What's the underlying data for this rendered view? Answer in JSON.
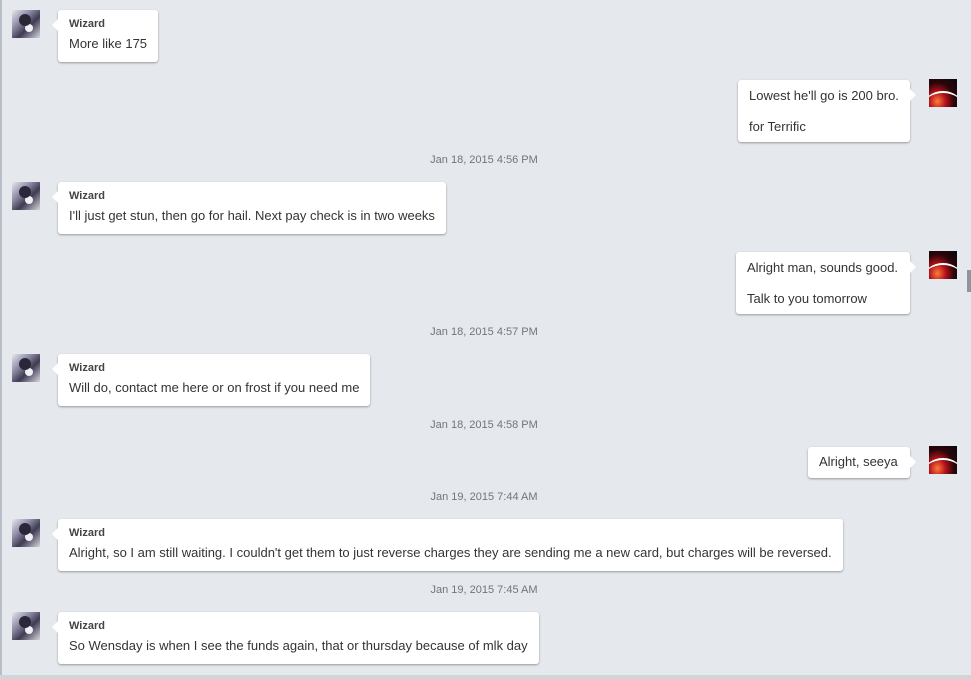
{
  "conversation": {
    "items": [
      {
        "type": "message",
        "side": "left",
        "sender": "Wizard",
        "lines": [
          "More like 175"
        ]
      },
      {
        "type": "message",
        "side": "right",
        "lines": [
          "Lowest he'll go is 200 bro.",
          "for Terrific"
        ]
      },
      {
        "type": "timestamp",
        "text": "Jan 18, 2015 4:56 PM"
      },
      {
        "type": "message",
        "side": "left",
        "sender": "Wizard",
        "lines": [
          "I'll just get stun, then go for hail. Next pay check is in two weeks"
        ]
      },
      {
        "type": "message",
        "side": "right",
        "lines": [
          "Alright man, sounds good.",
          "Talk to you tomorrow"
        ]
      },
      {
        "type": "timestamp",
        "text": "Jan 18, 2015 4:57 PM"
      },
      {
        "type": "message",
        "side": "left",
        "sender": "Wizard",
        "lines": [
          "Will do, contact me here or on frost if you need me"
        ]
      },
      {
        "type": "timestamp",
        "text": "Jan 18, 2015 4:58 PM"
      },
      {
        "type": "message",
        "side": "right",
        "lines": [
          "Alright, seeya"
        ]
      },
      {
        "type": "timestamp",
        "text": "Jan 19, 2015 7:44 AM"
      },
      {
        "type": "message",
        "side": "left",
        "sender": "Wizard",
        "lines": [
          "Alright, so I am still waiting. I couldn't get them to just reverse charges they are sending me a new card, but charges will be reversed."
        ]
      },
      {
        "type": "timestamp",
        "text": "Jan 19, 2015 7:45 AM"
      },
      {
        "type": "message",
        "side": "left",
        "sender": "Wizard",
        "lines": [
          "So Wensday is when I see the funds again, that or thursday because of mlk day"
        ]
      }
    ]
  },
  "icons": {
    "wizard_avatar": "wizard-avatar",
    "self_avatar": "space-planet-avatar"
  },
  "colors": {
    "background": "#e5e9ed",
    "bubble": "#ffffff",
    "timestamp": "#6f757b"
  }
}
